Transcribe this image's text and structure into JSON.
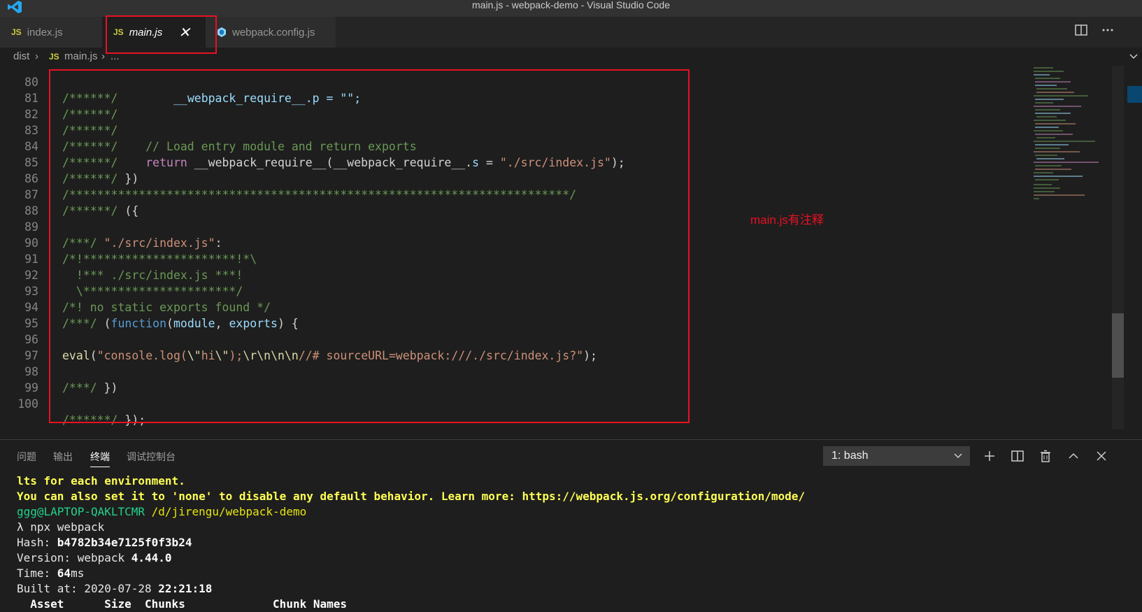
{
  "window": {
    "title": "main.js - webpack-demo - Visual Studio Code"
  },
  "tabs": [
    {
      "icon": "JS",
      "label": "index.js"
    },
    {
      "icon": "JS",
      "label": "main.js"
    },
    {
      "label": "webpack.config.js"
    }
  ],
  "breadcrumb": {
    "folder": "dist",
    "file_icon": "JS",
    "file": "main.js",
    "more": "..."
  },
  "code_lines": [
    {
      "n": "80",
      "text": "/******/ \t__webpack_require__.p = \"\";"
    },
    {
      "n": "81",
      "text": "/******/"
    },
    {
      "n": "82",
      "text": "/******/"
    },
    {
      "n": "83",
      "text": "/******/ \t// Load entry module and return exports"
    },
    {
      "n": "84",
      "text": "/******/ \treturn __webpack_require__(__webpack_require__.s = \"./src/index.js\");"
    },
    {
      "n": "85",
      "text": "/******/ })"
    },
    {
      "n": "86",
      "text": "/************************************************************************/"
    },
    {
      "n": "87",
      "text": "/******/ ({"
    },
    {
      "n": "88",
      "text": ""
    },
    {
      "n": "89",
      "text": "/***/ \"./src/index.js\":"
    },
    {
      "n": "90",
      "text": "/*!**********************!*\\"
    },
    {
      "n": "91",
      "text": "  !*** ./src/index.js ***!"
    },
    {
      "n": "92",
      "text": "  \\**********************/"
    },
    {
      "n": "93",
      "text": "/*! no static exports found */"
    },
    {
      "n": "94",
      "text": "/***/ (function(module, exports) {"
    },
    {
      "n": "95",
      "text": ""
    },
    {
      "n": "96",
      "text": "eval(\"console.log(\\\"hi\\\");\\r\\n\\n\\n//# sourceURL=webpack:///./src/index.js?\");"
    },
    {
      "n": "97",
      "text": ""
    },
    {
      "n": "98",
      "text": "/***/ })"
    },
    {
      "n": "99",
      "text": ""
    },
    {
      "n": "100",
      "text": "/******/ });"
    }
  ],
  "code_tokens": {
    "c80a": "/******/ \t",
    "c80b": "__webpack_require__.p = \"\";",
    "c81": "/******/",
    "c82": "/******/",
    "c83": "/******/    // Load entry module and return exports",
    "c84a": "/******/    ",
    "c84b": "return",
    "c84c": " __webpack_require__(__webpack_require__.",
    "c84d": "s",
    "c84e": " = ",
    "c84f": "\"./src/index.js\"",
    "c84g": ");",
    "c85a": "/******/",
    "c85b": " })",
    "c86": "/************************************************************************/",
    "c87a": "/******/",
    "c87b": " ({",
    "c89a": "/***/ ",
    "c89b": "\"./src/index.js\"",
    "c89c": ":",
    "c90": "/*!**********************!*\\",
    "c91": "  !*** ./src/index.js ***!",
    "c92": "  \\**********************/",
    "c93": "/*! no static exports found */",
    "c94a": "/***/ ",
    "c94b": "(",
    "c94c": "function",
    "c94d": "(",
    "c94e": "module",
    "c94f": ", ",
    "c94g": "exports",
    "c94h": ") {",
    "c96a": "eval",
    "c96b": "(",
    "c96c": "\"console.log(",
    "c96d": "\\\"",
    "c96e": "hi",
    "c96f": "\\\"",
    "c96g": ");",
    "c96h": "\\r\\n\\n\\n",
    "c96i": "//# sourceURL=webpack:///./src/index.js?\"",
    "c96j": ");",
    "c98a": "/***/",
    "c98b": " })",
    "c100a": "/******/",
    "c100b": " });"
  },
  "annotation": "main.js有注释",
  "panel": {
    "tabs": [
      "问题",
      "输出",
      "终端",
      "调试控制台"
    ],
    "active_tab": "终端",
    "terminal_select": "1: bash"
  },
  "terminal": {
    "line1": "lts for each environment.",
    "line2": "You can also set it to 'none' to disable any default behavior. Learn more: https://webpack.js.org/configuration/mode/",
    "user": "ggg@LAPTOP-QAKLTCMR",
    "path": " /d/jirengu/webpack-demo",
    "cmd": "λ npx webpack",
    "hash_label": "Hash: ",
    "hash": "b4782b34e7125f0f3b24",
    "version_label": "Version: webpack ",
    "version": "4.44.0",
    "time_label": "Time: ",
    "time": "64",
    "time_unit": "ms",
    "built_label": "Built at: 2020-07-28 ",
    "built_time": "22:21:18",
    "table_header": "  Asset      Size  Chunks             Chunk Names"
  },
  "colors": {
    "accent_red": "#e81123",
    "editor_bg": "#1e1e1e",
    "comment": "#6a9955",
    "string": "#ce9178"
  }
}
